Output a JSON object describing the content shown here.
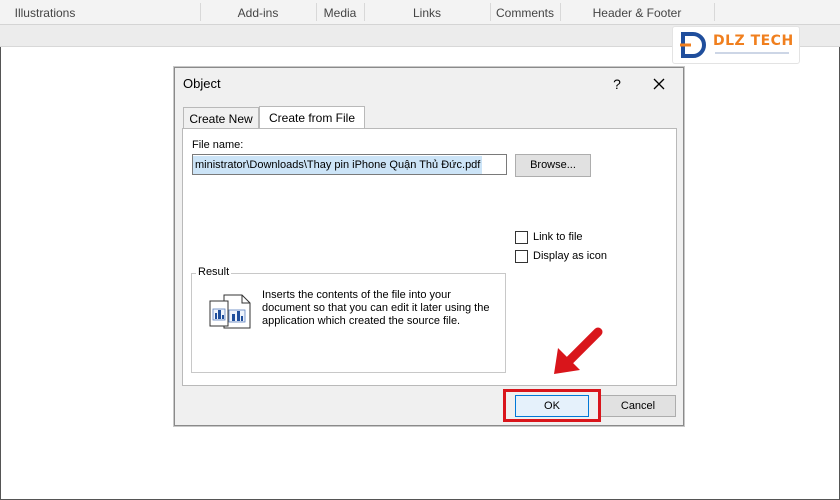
{
  "ribbon": {
    "groups": [
      "Illustrations",
      "Add-ins",
      "Media",
      "Links",
      "Comments",
      "Header & Footer"
    ]
  },
  "watermark": {
    "brand_text": "DLZ TECH",
    "brand_color": "#f07f1e",
    "accent_color": "#1f4e9c"
  },
  "dialog": {
    "title": "Object",
    "help_label": "?",
    "tabs": [
      {
        "label": "Create New",
        "active": false
      },
      {
        "label": "Create from File",
        "active": true
      }
    ],
    "file_name_label": "File name:",
    "file_name_value": "ministrator\\Downloads\\Thay pin iPhone Quận Thủ Đức.pdf",
    "browse_label": "Browse...",
    "link_to_file_label": "Link to file",
    "link_to_file_checked": false,
    "display_as_icon_label": "Display as icon",
    "display_as_icon_checked": false,
    "result_label": "Result",
    "result_text": "Inserts the contents of the file into your document so that you can edit it later using the application which created the source file.",
    "ok_label": "OK",
    "cancel_label": "Cancel"
  },
  "annotation": {
    "highlight_color": "#d9151b",
    "arrow_color": "#d9151b"
  }
}
